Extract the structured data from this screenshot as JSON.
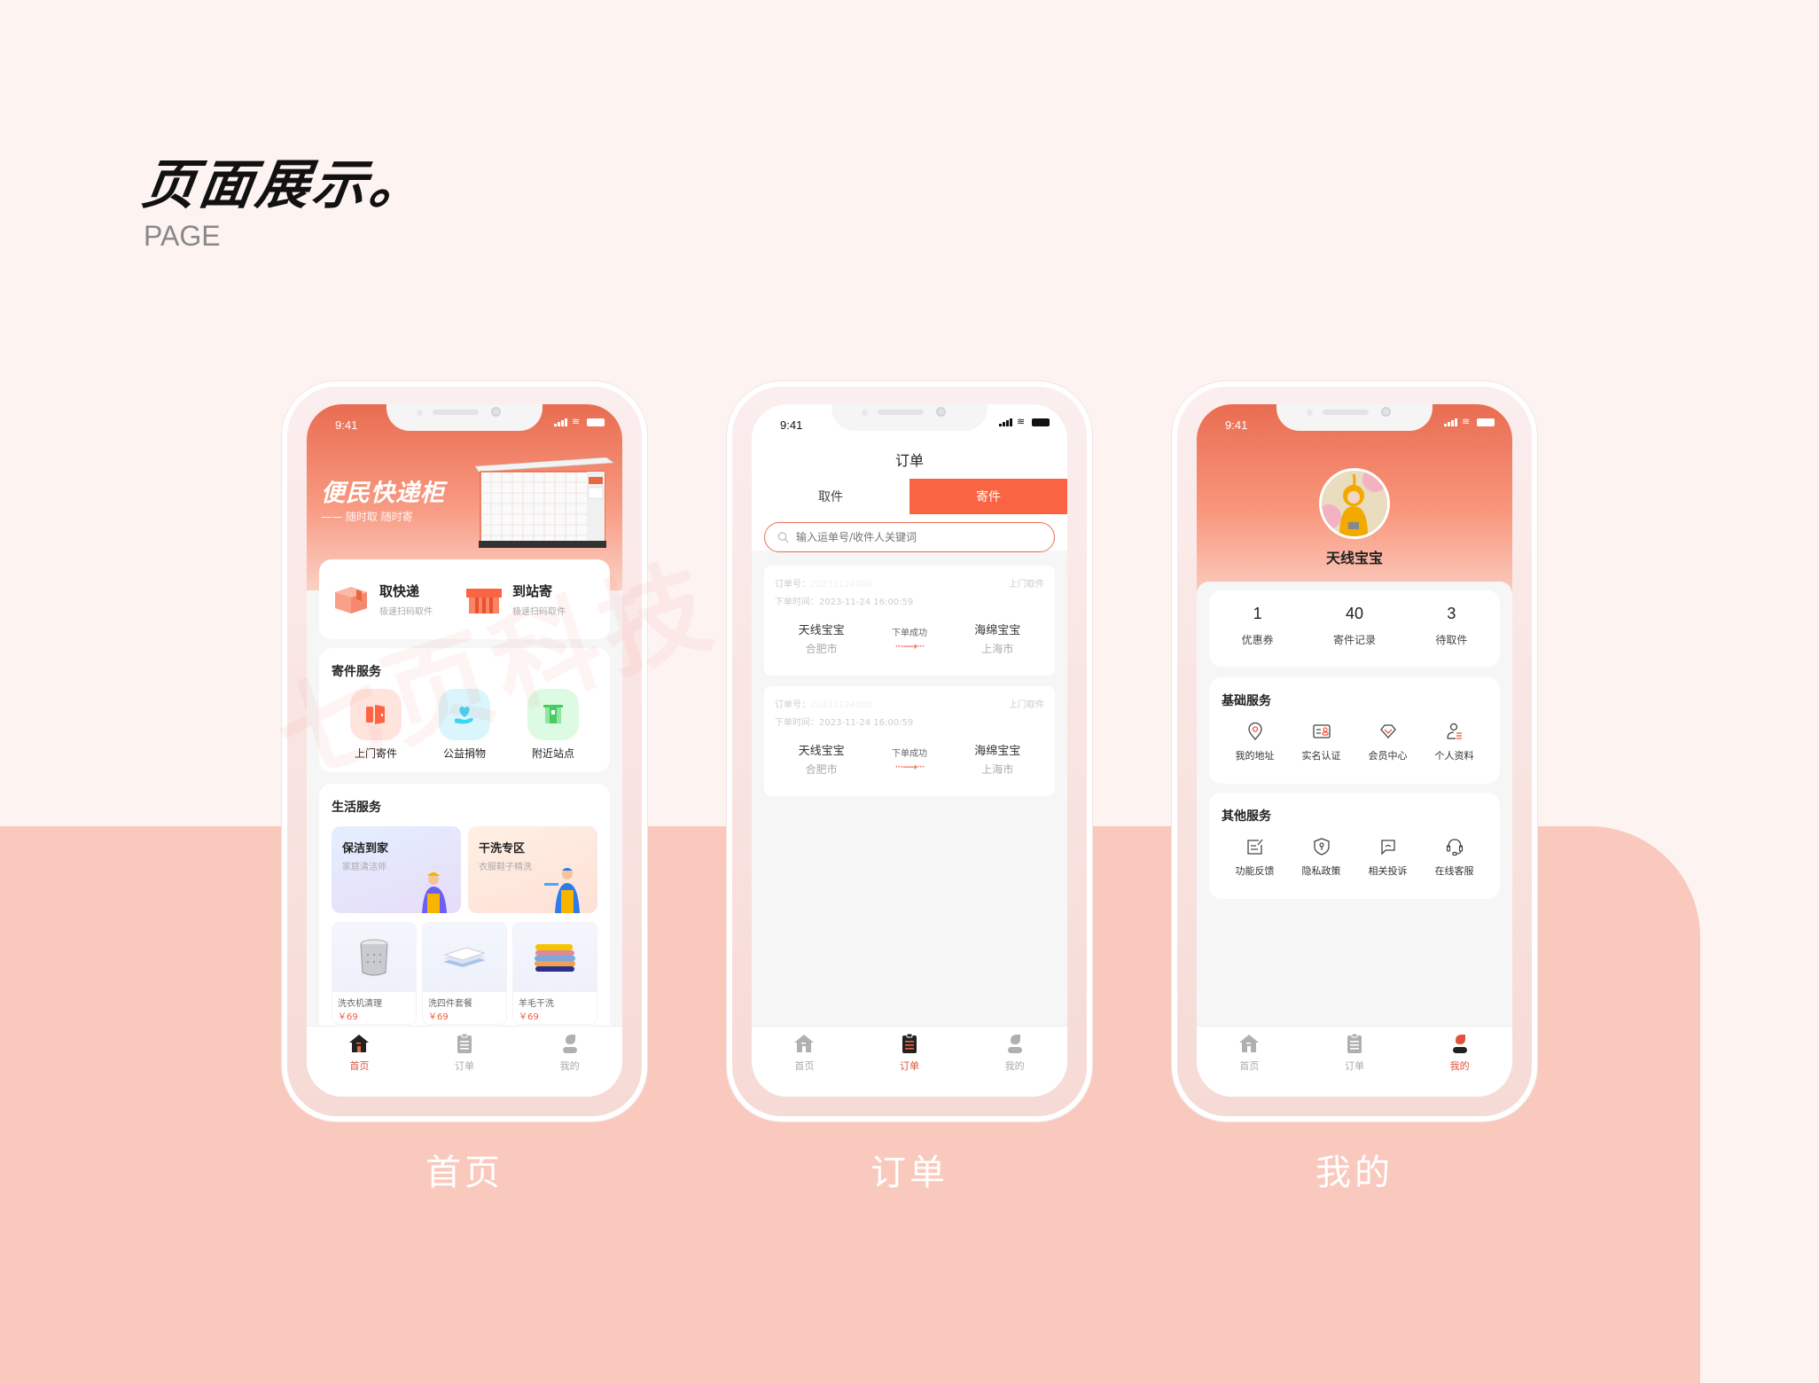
{
  "header": {
    "title": "页面展示。",
    "subtitle": "PAGE"
  },
  "watermark": "七页科技",
  "phones": {
    "home": {
      "label": "首页",
      "status_time": "9:41",
      "hero": {
        "title": "便民快递柜",
        "subtitle": "—— 随时取 随时寄",
        "locker_badge": "快递柜"
      },
      "quick": [
        {
          "title": "取快递",
          "desc": "极速扫码取件",
          "icon": "package-box-icon"
        },
        {
          "title": "到站寄",
          "desc": "极速扫码取件",
          "icon": "gift-box-icon"
        }
      ],
      "send_services": {
        "title": "寄件服务",
        "items": [
          {
            "label": "上门寄件",
            "icon": "door-icon",
            "color": "#fe6441",
            "bg": "#ffe4de"
          },
          {
            "label": "公益捐物",
            "icon": "heart-hand-icon",
            "color": "#3ad6f6",
            "bg": "#dbf5fc"
          },
          {
            "label": "附近站点",
            "icon": "station-icon",
            "color": "#47cc63",
            "bg": "#dcfbe2"
          }
        ]
      },
      "life_services": {
        "title": "生活服务",
        "promos": [
          {
            "title": "保洁到家",
            "desc": "家庭清洁师"
          },
          {
            "title": "干洗专区",
            "desc": "衣服鞋子精洗"
          }
        ],
        "products": [
          {
            "name": "洗衣机清理",
            "price": "￥69"
          },
          {
            "name": "洗四件套餐",
            "price": "￥69"
          },
          {
            "name": "羊毛干洗",
            "price": "￥69"
          }
        ]
      },
      "tabs": [
        {
          "label": "首页",
          "active": true
        },
        {
          "label": "订单"
        },
        {
          "label": "我的"
        }
      ]
    },
    "orders": {
      "label": "订单",
      "status_time": "9:41",
      "title": "订单",
      "segments": [
        {
          "label": "取件"
        },
        {
          "label": "寄件",
          "active": true
        }
      ],
      "search_placeholder": "输入运单号/收件人关键词",
      "orders": [
        {
          "order_no_label": "订单号：",
          "order_no": "20231124000",
          "type": "上门取件",
          "time_label": "下单时间：",
          "time": "2023-11-24 16:00:59",
          "sender": "天线宝宝",
          "sender_city": "合肥市",
          "status": "下单成功",
          "receiver": "海绵宝宝",
          "receiver_city": "上海市"
        },
        {
          "order_no_label": "订单号：",
          "order_no": "20231124000",
          "type": "上门取件",
          "time_label": "下单时间：",
          "time": "2023-11-24 16:00:59",
          "sender": "天线宝宝",
          "sender_city": "合肥市",
          "status": "下单成功",
          "receiver": "海绵宝宝",
          "receiver_city": "上海市"
        }
      ],
      "tabs": [
        {
          "label": "首页"
        },
        {
          "label": "订单",
          "active": true
        },
        {
          "label": "我的"
        }
      ]
    },
    "profile": {
      "label": "我的",
      "status_time": "9:41",
      "username": "天线宝宝",
      "stats": [
        {
          "value": "1",
          "label": "优惠券"
        },
        {
          "value": "40",
          "label": "寄件记录"
        },
        {
          "value": "3",
          "label": "待取件"
        }
      ],
      "basic_services": {
        "title": "基础服务",
        "items": [
          {
            "label": "我的地址",
            "icon": "location-pin-icon"
          },
          {
            "label": "实名认证",
            "icon": "id-card-icon"
          },
          {
            "label": "会员中心",
            "icon": "diamond-icon"
          },
          {
            "label": "个人资料",
            "icon": "user-profile-icon"
          }
        ]
      },
      "other_services": {
        "title": "其他服务",
        "items": [
          {
            "label": "功能反馈",
            "icon": "feedback-edit-icon"
          },
          {
            "label": "隐私政策",
            "icon": "shield-key-icon"
          },
          {
            "label": "相关投诉",
            "icon": "chat-bubble-icon"
          },
          {
            "label": "在线客服",
            "icon": "headset-icon"
          }
        ]
      },
      "tabs": [
        {
          "label": "首页"
        },
        {
          "label": "订单"
        },
        {
          "label": "我的",
          "active": true
        }
      ]
    }
  },
  "colors": {
    "accent": "#f96442",
    "active_tab": "#e0533a",
    "band": "#f9c9be",
    "page_bg": "#fdf4f2"
  }
}
